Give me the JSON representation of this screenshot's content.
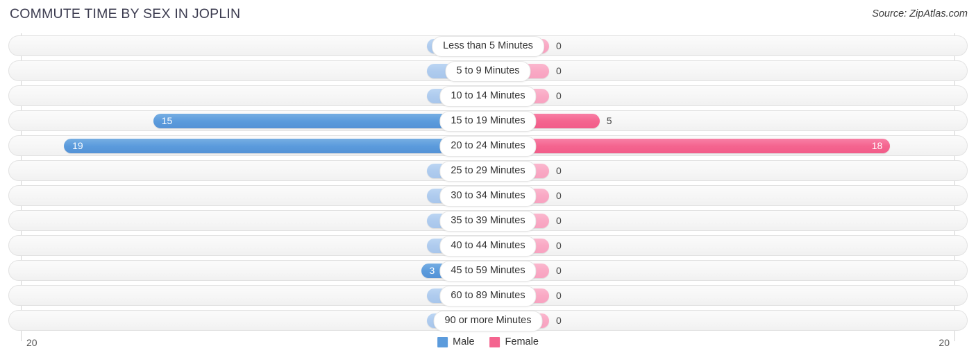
{
  "header": {
    "title": "COMMUTE TIME BY SEX IN JOPLIN",
    "source": "Source: ZipAtlas.com"
  },
  "legend": {
    "male_label": "Male",
    "female_label": "Female",
    "male_color": "#5b9bdc",
    "female_color": "#f4648f"
  },
  "axis": {
    "left_tick": "20",
    "right_tick": "20"
  },
  "chart_data": {
    "type": "bar",
    "title": "COMMUTE TIME BY SEX IN JOPLIN",
    "subtitle": "Source: ZipAtlas.com",
    "orientation": "horizontal-diverging",
    "xlabel": "",
    "ylabel": "",
    "xlim": [
      20,
      20
    ],
    "grid": false,
    "legend_position": "bottom-center",
    "categories": [
      "Less than 5 Minutes",
      "5 to 9 Minutes",
      "10 to 14 Minutes",
      "15 to 19 Minutes",
      "20 to 24 Minutes",
      "25 to 29 Minutes",
      "30 to 34 Minutes",
      "35 to 39 Minutes",
      "40 to 44 Minutes",
      "45 to 59 Minutes",
      "60 to 89 Minutes",
      "90 or more Minutes"
    ],
    "series": [
      {
        "name": "Male",
        "color": "#5b9bdc",
        "side": "left",
        "values": [
          0,
          0,
          0,
          15,
          19,
          0,
          0,
          0,
          0,
          3,
          0,
          0
        ]
      },
      {
        "name": "Female",
        "color": "#f4648f",
        "side": "right",
        "values": [
          0,
          0,
          0,
          5,
          18,
          0,
          0,
          0,
          0,
          0,
          0,
          0
        ]
      }
    ]
  },
  "rows": [
    {
      "label": "Less than 5 Minutes",
      "male": "0",
      "female": "0"
    },
    {
      "label": "5 to 9 Minutes",
      "male": "0",
      "female": "0"
    },
    {
      "label": "10 to 14 Minutes",
      "male": "0",
      "female": "0"
    },
    {
      "label": "15 to 19 Minutes",
      "male": "15",
      "female": "5"
    },
    {
      "label": "20 to 24 Minutes",
      "male": "19",
      "female": "18"
    },
    {
      "label": "25 to 29 Minutes",
      "male": "0",
      "female": "0"
    },
    {
      "label": "30 to 34 Minutes",
      "male": "0",
      "female": "0"
    },
    {
      "label": "35 to 39 Minutes",
      "male": "0",
      "female": "0"
    },
    {
      "label": "40 to 44 Minutes",
      "male": "0",
      "female": "0"
    },
    {
      "label": "45 to 59 Minutes",
      "male": "3",
      "female": "0"
    },
    {
      "label": "60 to 89 Minutes",
      "male": "0",
      "female": "0"
    },
    {
      "label": "90 or more Minutes",
      "male": "0",
      "female": "0"
    }
  ]
}
